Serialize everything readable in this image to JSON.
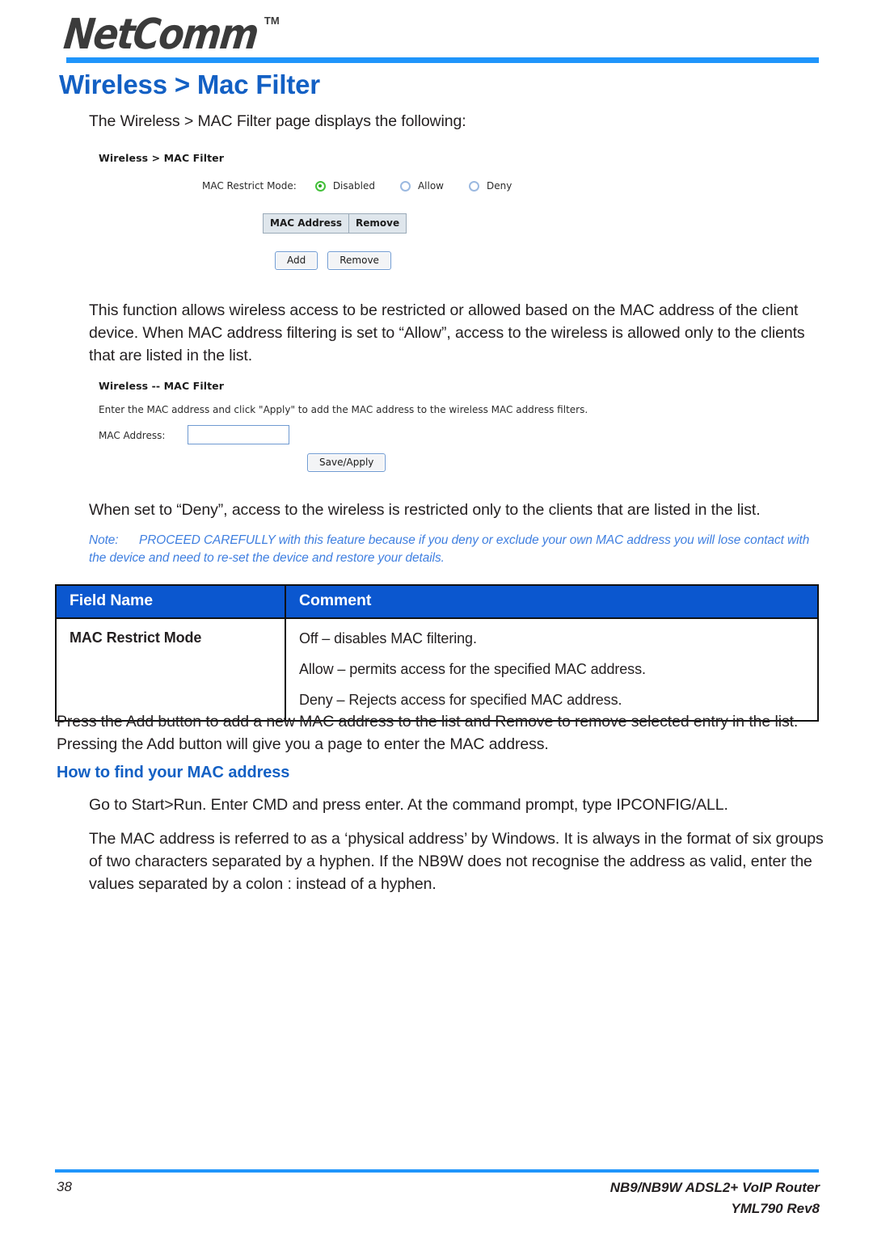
{
  "header": {
    "logo_text": "NetComm",
    "logo_trademark": "TM",
    "accent_color": "#1f95fb"
  },
  "page_title": "Wireless > Mac Filter",
  "intro_paragraph": "The Wireless > MAC Filter page displays the following:",
  "screenshot_one": {
    "title": "Wireless > MAC Filter",
    "restrict_mode_label": "MAC Restrict Mode:",
    "radio_options": [
      {
        "label": "Disabled",
        "selected": true
      },
      {
        "label": "Allow",
        "selected": false
      },
      {
        "label": "Deny",
        "selected": false
      }
    ],
    "table_headers": [
      "MAC Address",
      "Remove"
    ],
    "buttons": [
      "Add",
      "Remove"
    ]
  },
  "body_paragraph_one": "This function allows wireless access to be restricted or allowed based on the MAC address of the client device. When MAC address filtering is set to “Allow”, access to the wireless is allowed only to the clients that are listed in the list.",
  "screenshot_two": {
    "title": "Wireless -- MAC Filter",
    "instruction": "Enter the MAC address and click \"Apply\" to add the MAC address to the wireless MAC address filters.",
    "field_label": "MAC Address:",
    "field_value": "",
    "field_placeholder": "",
    "button": "Save/Apply"
  },
  "body_paragraph_two": "When set to “Deny”, access to the wireless is restricted only to the clients that are listed in the list.",
  "note": {
    "label": "Note:",
    "text": "PROCEED CAREFULLY with this feature because if you deny or exclude your own MAC address you will lose contact with the device and need to re-set the device and restore your details.",
    "color": "#3f7fe0"
  },
  "table": {
    "header_color": "#0b57cf",
    "columns": [
      "Field Name",
      "Comment"
    ],
    "rows": [
      {
        "field": "MAC Restrict Mode",
        "comments": [
          "Off – disables MAC filtering.",
          "Allow – permits access for the specified MAC address.",
          "Deny – Rejects access for specified MAC address."
        ]
      }
    ]
  },
  "body_paragraph_three": "Press the Add button to add a new MAC address to the list and Remove to remove selected entry in the list. Pressing the Add button will give you a page to enter the MAC address.",
  "subheading": "How to find your MAC address",
  "body_paragraph_four": "Go to Start>Run. Enter CMD and press enter.  At the command prompt, type IPCONFIG/ALL.",
  "body_paragraph_five": "The MAC address is referred to as a ‘physical address’ by Windows.  It is always in the format of six groups of two characters separated by a hyphen. If the NB9W does not recognise the address as valid, enter the values separated by a colon : instead of a hyphen.",
  "footer": {
    "page_number": "38",
    "product": "NB9/NB9W ADSL2+ VoIP Router",
    "doc_code": "YML790 Rev8"
  }
}
